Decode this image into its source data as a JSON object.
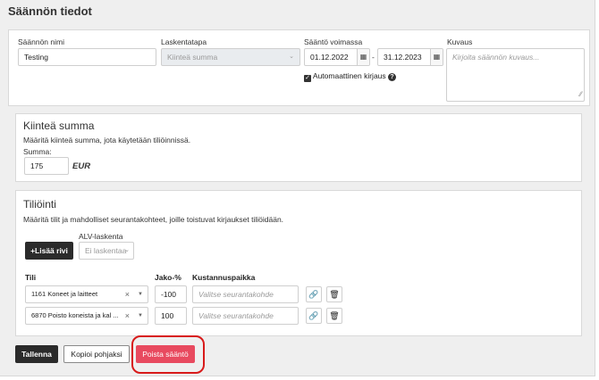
{
  "header": {
    "title": "Säännön tiedot"
  },
  "rule": {
    "name_label": "Säännön nimi",
    "name_value": "Testing",
    "calc_label": "Laskentatapa",
    "calc_value": "Kiinteä summa",
    "validity_label": "Sääntö voimassa",
    "date_start": "01.12.2022",
    "date_end": "31.12.2023",
    "date_separator": "-",
    "auto_label": "Automaattinen kirjaus",
    "auto_checked": true,
    "desc_label": "Kuvaus",
    "desc_placeholder": "Kirjoita säännön kuvaus..."
  },
  "fixed": {
    "heading": "Kiinteä summa",
    "description": "Määritä kiinteä summa, jota käytetään tiliöinnissä.",
    "amount_label": "Summa:",
    "amount_value": "175",
    "currency": "EUR"
  },
  "posting": {
    "heading": "Tiliöinti",
    "description": "Määritä tilit ja mahdolliset seurantakohteet, joille toistuvat kirjaukset tiliöidään.",
    "add_row_label": "+Lisää rivi",
    "vat_label": "ALV-laskenta",
    "vat_value": "Ei laskentaa",
    "col_account": "Tili",
    "col_share": "Jako-%",
    "col_cost": "Kustannuspaikka",
    "rows": [
      {
        "account": "1161 Koneet ja laitteet",
        "share": "-100",
        "cost_placeholder": "Valitse seurantakohde"
      },
      {
        "account": "6870 Poisto koneista ja kal ...",
        "share": "100",
        "cost_placeholder": "Valitse seurantakohde"
      }
    ]
  },
  "actions": {
    "save_label": "Tallenna",
    "copy_label": "Kopioi pohjaksi",
    "delete_label": "Poista sääntö"
  },
  "colors": {
    "danger": "#e84a5f",
    "highlight": "#d81a1a",
    "dark": "#2b2b2b"
  }
}
